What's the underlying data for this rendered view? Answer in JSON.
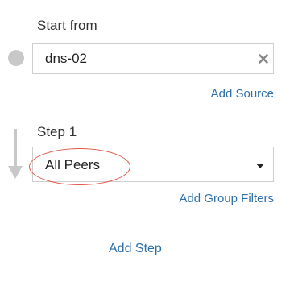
{
  "source": {
    "heading": "Start from",
    "value": "dns-02",
    "clear_icon": "close-icon",
    "add_link": "Add Source"
  },
  "step": {
    "heading": "Step 1",
    "selected": "All Peers",
    "dropdown_icon": "caret-down-icon",
    "filter_link": "Add Group Filters"
  },
  "actions": {
    "add_step": "Add Step"
  },
  "colors": {
    "link": "#2f6fa8",
    "highlight_circle": "#e0564a",
    "connector": "#c8c8c8"
  }
}
